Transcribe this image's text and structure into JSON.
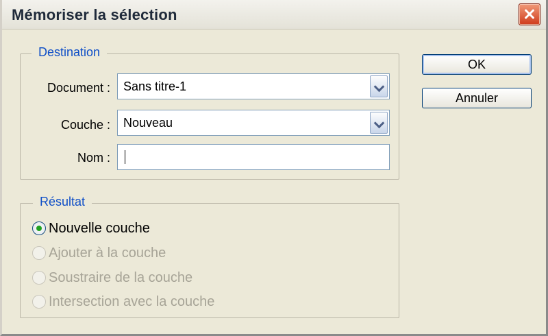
{
  "dialog": {
    "title": "Mémoriser la sélection"
  },
  "destination": {
    "legend": "Destination",
    "document_label": "Document :",
    "document_value": "Sans titre-1",
    "channel_label": "Couche :",
    "channel_value": "Nouveau",
    "name_label": "Nom :",
    "name_value": ""
  },
  "result": {
    "legend": "Résultat",
    "options": [
      {
        "label": "Nouvelle couche",
        "checked": true,
        "enabled": true
      },
      {
        "label": "Ajouter à la couche",
        "checked": false,
        "enabled": false
      },
      {
        "label": "Soustraire de la couche",
        "checked": false,
        "enabled": false
      },
      {
        "label": "Intersection avec la couche",
        "checked": false,
        "enabled": false
      }
    ]
  },
  "buttons": {
    "ok": "OK",
    "cancel": "Annuler"
  },
  "icons": {
    "close": "close-icon",
    "dropdown": "chevron-down-icon",
    "radio_checked": "radio-checked-icon",
    "radio_unchecked": "radio-unchecked-icon"
  },
  "colors": {
    "legend_text": "#0e4ec7",
    "dialog_bg": "#ece9d8",
    "close_button": "#cf3b1c"
  }
}
